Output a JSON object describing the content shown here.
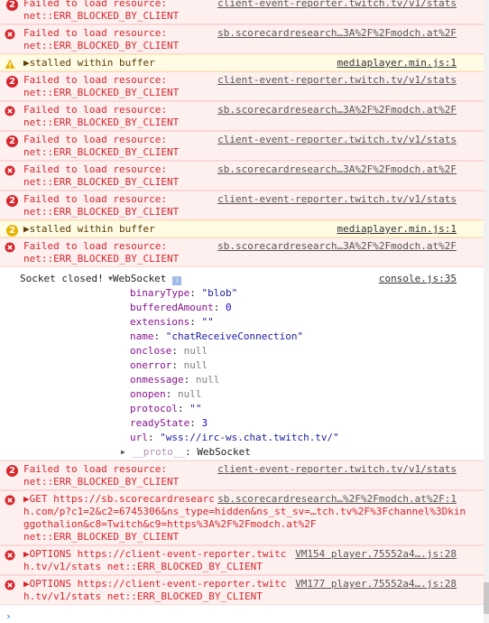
{
  "messages": [
    {
      "kind": "error",
      "count": "2",
      "lines": [
        "Failed to load resource: ",
        "net::ERR_BLOCKED_BY_CLIENT"
      ],
      "source": "client-event-reporter.twitch.tv/v1/stats",
      "top": 0,
      "h": 41
    },
    {
      "kind": "error",
      "count": "",
      "lines": [
        "Failed to load resource: ",
        "net::ERR_BLOCKED_BY_CLIENT"
      ],
      "source": "sb.scorecardresearch…3A%2F%2Fmodch.at%2F"
    },
    {
      "kind": "warn",
      "count": "",
      "lines": [
        "▶stalled within buffer"
      ],
      "source": "mediaplayer.min.js:1"
    },
    {
      "kind": "error",
      "count": "2",
      "lines": [
        "Failed to load resource: ",
        "net::ERR_BLOCKED_BY_CLIENT"
      ],
      "source": "client-event-reporter.twitch.tv/v1/stats"
    },
    {
      "kind": "error",
      "count": "",
      "lines": [
        "Failed to load resource: ",
        "net::ERR_BLOCKED_BY_CLIENT"
      ],
      "source": "sb.scorecardresearch…3A%2F%2Fmodch.at%2F"
    },
    {
      "kind": "error",
      "count": "2",
      "lines": [
        "Failed to load resource: ",
        "net::ERR_BLOCKED_BY_CLIENT"
      ],
      "source": "client-event-reporter.twitch.tv/v1/stats"
    },
    {
      "kind": "error",
      "count": "",
      "lines": [
        "Failed to load resource: ",
        "net::ERR_BLOCKED_BY_CLIENT"
      ],
      "source": "sb.scorecardresearch…3A%2F%2Fmodch.at%2F"
    },
    {
      "kind": "error",
      "count": "2",
      "lines": [
        "Failed to load resource: ",
        "net::ERR_BLOCKED_BY_CLIENT"
      ],
      "source": "client-event-reporter.twitch.tv/v1/stats"
    },
    {
      "kind": "warn",
      "count": "2",
      "lines": [
        "▶stalled within buffer"
      ],
      "source": "mediaplayer.min.js:1"
    },
    {
      "kind": "error",
      "count": "",
      "lines": [
        "Failed to load resource: ",
        "net::ERR_BLOCKED_BY_CLIENT"
      ],
      "source": "sb.scorecardresearch…3A%2F%2Fmodch.at%2F"
    }
  ],
  "websocket_log": {
    "prefix": "Socket closed! ",
    "label": "WebSocket",
    "info": "i",
    "source": "console.js:35",
    "props": [
      {
        "key": "binaryType",
        "val": "\"blob\"",
        "type": "str"
      },
      {
        "key": "bufferedAmount",
        "val": "0",
        "type": "num"
      },
      {
        "key": "extensions",
        "val": "\"\"",
        "type": "str"
      },
      {
        "key": "name",
        "val": "\"chatReceiveConnection\"",
        "type": "str"
      },
      {
        "key": "onclose",
        "val": "null",
        "type": "nul"
      },
      {
        "key": "onerror",
        "val": "null",
        "type": "nul"
      },
      {
        "key": "onmessage",
        "val": "null",
        "type": "nul"
      },
      {
        "key": "onopen",
        "val": "null",
        "type": "nul"
      },
      {
        "key": "protocol",
        "val": "\"\"",
        "type": "str"
      },
      {
        "key": "readyState",
        "val": "3",
        "type": "num"
      },
      {
        "key": "url",
        "val": "\"wss://irc-ws.chat.twitch.tv/\"",
        "type": "str"
      }
    ],
    "proto_key": "__proto__",
    "proto_val": "WebSocket"
  },
  "bottom_messages": [
    {
      "kind": "error",
      "count": "2",
      "lines": [
        "Failed to load resource: ",
        "net::ERR_BLOCKED_BY_CLIENT"
      ],
      "source": "client-event-reporter.twitch.tv/v1/stats"
    },
    {
      "kind": "error",
      "count": "",
      "lines": [
        "▶GET https://sb.scorecardresearc",
        "h.com/p?c1=2&c2=6745306&ns_type=hidden&ns_st_sv=…tch.tv%2F%3Fchannel%3Dkin",
        "ggothalion&c8=Twitch&c9=https%3A%2F%2Fmodch.at%2F",
        "net::ERR_BLOCKED_BY_CLIENT"
      ],
      "source": "sb.scorecardresearch…%2F%2Fmodch.at%2F:1"
    },
    {
      "kind": "error",
      "count": "",
      "lines": [
        "▶OPTIONS https://client-event-reporter.twitc",
        "h.tv/v1/stats net::ERR_BLOCKED_BY_CLIENT"
      ],
      "source": "VM154 player.75552a4….js:28"
    },
    {
      "kind": "error",
      "count": "",
      "lines": [
        "▶OPTIONS https://client-event-reporter.twitc",
        "h.tv/v1/stats net::ERR_BLOCKED_BY_CLIENT"
      ],
      "source": "VM177 player.75552a4….js:28"
    }
  ],
  "prompt_symbol": "›"
}
